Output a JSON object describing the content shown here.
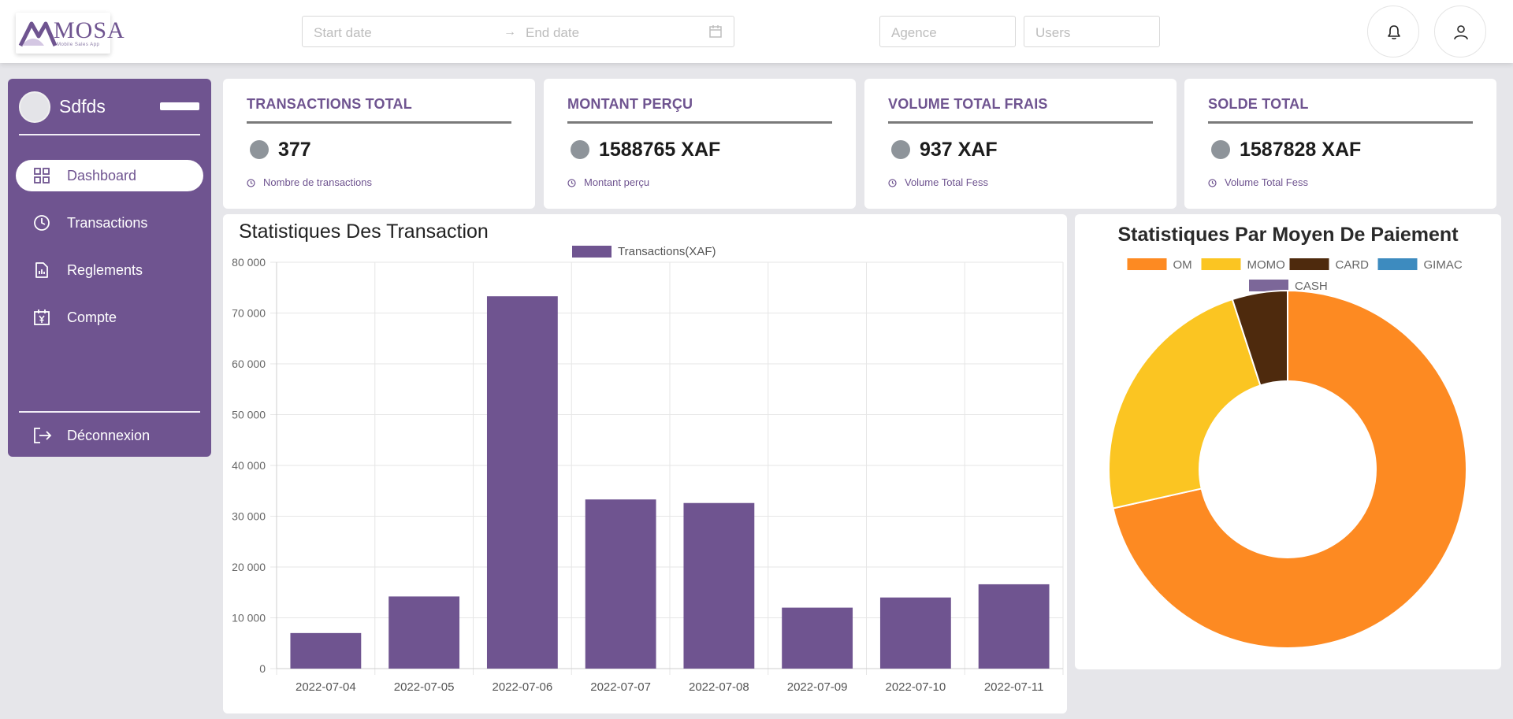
{
  "brand": {
    "name": "MOSA",
    "tagline": "Mobile Sales App"
  },
  "filters": {
    "start_placeholder": "Start date",
    "range_separator": "→",
    "end_placeholder": "End date",
    "agence_placeholder": "Agence",
    "users_placeholder": "Users"
  },
  "sidebar": {
    "username": "Sdfds",
    "items": [
      {
        "label": "Dashboard",
        "icon": "grid-icon",
        "active": true
      },
      {
        "label": "Transactions",
        "icon": "clock-icon",
        "active": false
      },
      {
        "label": "Reglements",
        "icon": "report-icon",
        "active": false
      },
      {
        "label": "Compte",
        "icon": "calendar-yen-icon",
        "active": false
      }
    ],
    "logout_label": "Déconnexion"
  },
  "cards": [
    {
      "title": "TRANSACTIONS TOTAL",
      "value": "377",
      "note": "Nombre de transactions"
    },
    {
      "title": "MONTANT PERÇU",
      "value": "1588765 XAF",
      "note": "Montant perçu"
    },
    {
      "title": "VOLUME TOTAL FRAIS",
      "value": "937 XAF",
      "note": "Volume Total Fess"
    },
    {
      "title": "SOLDE TOTAL",
      "value": "1587828 XAF",
      "note": "Volume Total Fess"
    }
  ],
  "colors": {
    "accent": "#6f5490",
    "bar": "#6f5490"
  },
  "chart_data": [
    {
      "type": "bar",
      "title": "Statistiques Des Transaction",
      "categories": [
        "2022-07-04",
        "2022-07-05",
        "2022-07-06",
        "2022-07-07",
        "2022-07-08",
        "2022-07-09",
        "2022-07-10",
        "2022-07-11"
      ],
      "series": [
        {
          "name": "Transactions(XAF)",
          "values": [
            7000,
            14200,
            73300,
            33300,
            32600,
            12000,
            14000,
            16600
          ],
          "color": "#6f5490"
        }
      ],
      "ylim": [
        0,
        80000
      ],
      "yticks": [
        0,
        10000,
        20000,
        30000,
        40000,
        50000,
        60000,
        70000,
        80000
      ],
      "ytick_labels": [
        "0",
        "10 000",
        "20 000",
        "30 000",
        "40 000",
        "50 000",
        "60 000",
        "70 000",
        "80 000"
      ],
      "grid": true,
      "legend": "top-center"
    },
    {
      "type": "pie",
      "title": "Statistiques Par Moyen De Paiement",
      "labels": [
        "OM",
        "MOMO",
        "CARD",
        "GIMAC",
        "CASH"
      ],
      "values": [
        71.5,
        23.5,
        5,
        0,
        0
      ],
      "colors": [
        "#fd8a22",
        "#fbc522",
        "#4e2a0d",
        "#3d8bbf",
        "#7c6799"
      ],
      "donut": true,
      "legend": "top-center"
    }
  ]
}
